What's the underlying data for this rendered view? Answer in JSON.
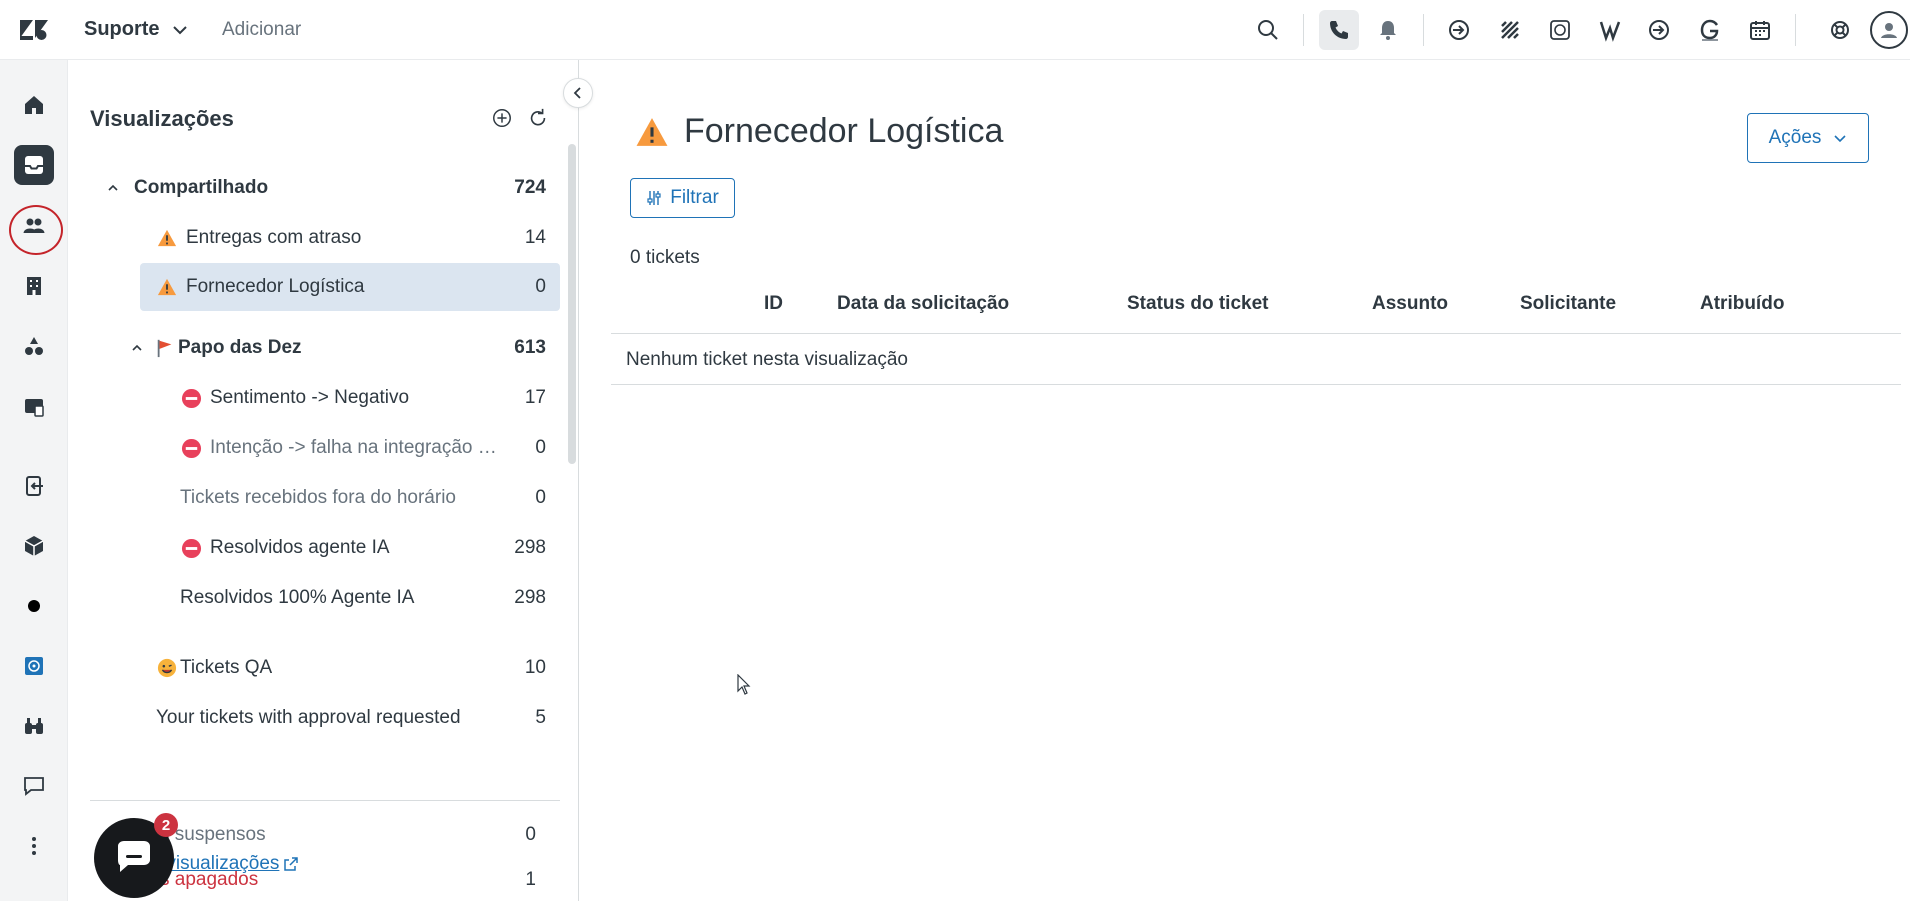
{
  "topbar": {
    "product": "Suporte",
    "add_label": "Adicionar",
    "icons": [
      "search-icon",
      "phone-icon",
      "bell-icon",
      "arrow-circle-icon",
      "grid-icon",
      "whatsapp-icon",
      "w-logo-icon",
      "arrow-circle-icon",
      "g-logo-icon",
      "calendar-icon",
      "lifebuoy-icon",
      "avatar-icon"
    ]
  },
  "leftnav": {
    "items": [
      "home-icon",
      "inbox-icon",
      "users-icon",
      "building-icon",
      "shapes-icon",
      "reports-icon",
      "exit-icon",
      "box-icon",
      "dot-icon",
      "app-icon",
      "binoculars-icon",
      "chat-icon",
      "more-icon"
    ]
  },
  "views": {
    "title": "Visualizações",
    "groups": {
      "shared": {
        "label": "Compartilhado",
        "count": "724"
      },
      "papo": {
        "label": "Papo das Dez",
        "count": "613"
      }
    },
    "items": [
      {
        "label": "Entregas com atraso",
        "count": "14"
      },
      {
        "label": "Fornecedor Logística",
        "count": "0"
      },
      {
        "label": "Sentimento -> Negativo",
        "count": "17"
      },
      {
        "label": "Intenção -> falha na integração com sistema",
        "count": "0"
      },
      {
        "label": "Tickets recebidos fora do horário",
        "count": "0"
      },
      {
        "label": "Resolvidos agente IA",
        "count": "298"
      },
      {
        "label": "Resolvidos 100% Agente IA",
        "count": "298"
      },
      {
        "label": "Tickets QA",
        "count": "10"
      },
      {
        "label": "Your tickets with approval requested",
        "count": "5"
      }
    ],
    "suspended": {
      "label": "Tickets suspensos",
      "count": "0"
    },
    "deleted": {
      "label": "Tickets apagados",
      "count": "1"
    },
    "manage_link": "iar visualizações"
  },
  "chat": {
    "badge": "2"
  },
  "main": {
    "title": "Fornecedor Logística",
    "actions_label": "Ações",
    "filter_label": "Filtrar",
    "ticket_count": "0 tickets",
    "columns": [
      "ID",
      "Data da solicitação",
      "Status do ticket",
      "Assunto",
      "Solicitante",
      "Atribuído"
    ],
    "empty_message": "Nenhum ticket nesta visualização"
  },
  "colors": {
    "accent": "#1f73b7",
    "selected": "#dbe5f0",
    "danger": "#cc3340",
    "warning": "#f79a3e"
  }
}
